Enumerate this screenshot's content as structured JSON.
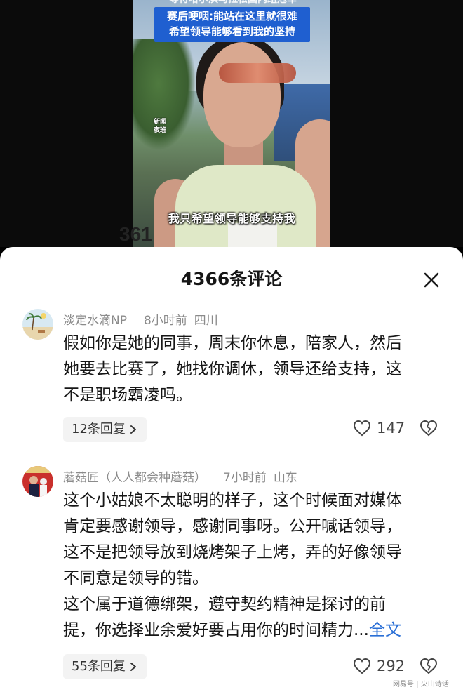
{
  "video": {
    "banner_top_text": "等待哈尔滨马拉松国内组冠军",
    "banner_line1": "赛后哽咽:能站在这里就很难",
    "banner_line2": "希望领导能够看到我的坚持",
    "news_logo_line1": "新闻",
    "news_logo_line2": "夜班",
    "subtitle": "我只希望领导能够支持我",
    "bib_number": "361"
  },
  "sheet": {
    "title": "4366条评论",
    "close_icon": "close-icon"
  },
  "comments": [
    {
      "author": "淡定水滴NP",
      "time": "8小时前",
      "location": "四川",
      "lines": [
        "假如你是她的同事，周末你休息，陪家人，然后",
        "她要去比赛了，她找你调休，领导还给支持，这",
        "不是职场霸凌吗。"
      ],
      "replies_label": "12条回复",
      "likes": "147"
    },
    {
      "author": "蘑菇匠（人人都会种蘑菇）",
      "time": "7小时前",
      "location": "山东",
      "lines": [
        "这个小姑娘不太聪明的样子，这个时候面对媒体",
        "肯定要感谢领导，感谢同事呀。公开喊话领导，",
        "这不是把领导放到烧烤架子上烤，弄的好像领导",
        "不同意是领导的错。",
        "这个属于道德绑架，遵守契约精神是探讨的前",
        "提，你选择业余爱好要占用你的时间精力..."
      ],
      "full_text_label": "全文",
      "replies_label": "55条回复",
      "likes": "292"
    }
  ],
  "watermark": "网易号 | 火山诗话"
}
